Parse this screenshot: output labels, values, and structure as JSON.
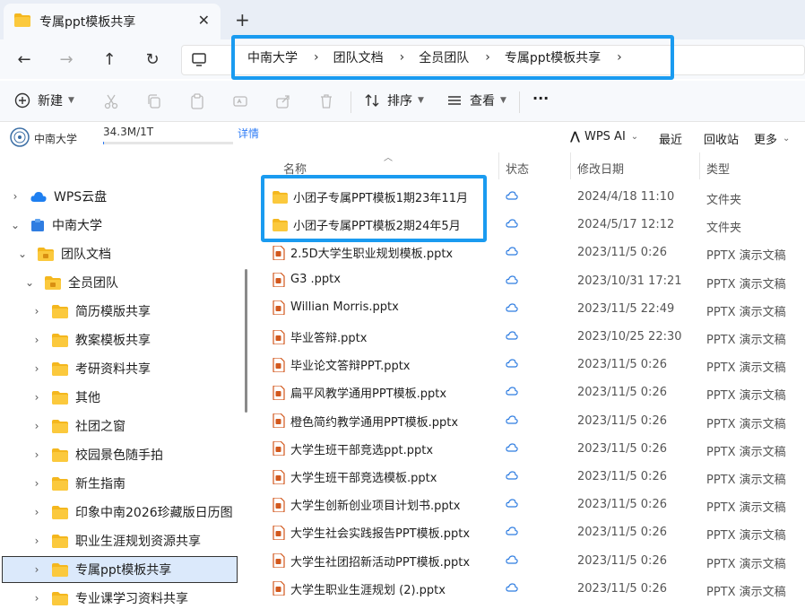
{
  "tab": {
    "title": "专属ppt模板共享",
    "close": "✕",
    "new": "+"
  },
  "nav": {
    "back": "←",
    "forward": "→",
    "up": "↑",
    "refresh": "↻",
    "breadcrumbs": [
      "中南大学",
      "团队文档",
      "全员团队",
      "专属ppt模板共享"
    ],
    "sep": "›"
  },
  "toolbar": {
    "new_label": "新建",
    "sort_label": "排序",
    "view_label": "查看",
    "more_label": "···"
  },
  "infobar": {
    "org": "中南大学",
    "quota": "34.3M/1T",
    "quota_fraction": 0.01,
    "detail": "详情",
    "wps_ai": "WPS AI",
    "recent": "最近",
    "recycle": "回收站",
    "more": "更多"
  },
  "sidebar": {
    "items": [
      {
        "label": "WPS云盘"
      },
      {
        "label": "中南大学"
      },
      {
        "label": "团队文档"
      },
      {
        "label": "全员团队"
      },
      {
        "label": "简历模版共享"
      },
      {
        "label": "教案模板共享"
      },
      {
        "label": "考研资料共享"
      },
      {
        "label": "其他"
      },
      {
        "label": "社团之窗"
      },
      {
        "label": "校园景色随手拍"
      },
      {
        "label": "新生指南"
      },
      {
        "label": "印象中南2026珍藏版日历图"
      },
      {
        "label": "职业生涯规划资源共享"
      },
      {
        "label": "专属ppt模板共享"
      },
      {
        "label": "专业课学习资料共享"
      }
    ]
  },
  "list": {
    "headers": {
      "name": "名称",
      "status": "状态",
      "date": "修改日期",
      "type": "类型"
    },
    "rows": [
      {
        "name": "小团子专属PPT模板1期23年11月",
        "date": "2024/4/18 11:10",
        "type": "文件夹"
      },
      {
        "name": "小团子专属PPT模板2期24年5月",
        "date": "2024/5/17 12:12",
        "type": "文件夹"
      },
      {
        "name": "2.5D大学生职业规划模板.pptx",
        "date": "2023/11/5 0:26",
        "type": "PPTX 演示文稿"
      },
      {
        "name": "G3 .pptx",
        "date": "2023/10/31 17:21",
        "type": "PPTX 演示文稿"
      },
      {
        "name": "Willian Morris.pptx",
        "date": "2023/11/5 22:49",
        "type": "PPTX 演示文稿"
      },
      {
        "name": "毕业答辩.pptx",
        "date": "2023/10/25 22:30",
        "type": "PPTX 演示文稿"
      },
      {
        "name": "毕业论文答辩PPT.pptx",
        "date": "2023/11/5 0:26",
        "type": "PPTX 演示文稿"
      },
      {
        "name": "扁平风教学通用PPT模板.pptx",
        "date": "2023/11/5 0:26",
        "type": "PPTX 演示文稿"
      },
      {
        "name": "橙色简约教学通用PPT模板.pptx",
        "date": "2023/11/5 0:26",
        "type": "PPTX 演示文稿"
      },
      {
        "name": "大学生班干部竞选ppt.pptx",
        "date": "2023/11/5 0:26",
        "type": "PPTX 演示文稿"
      },
      {
        "name": "大学生班干部竞选模板.pptx",
        "date": "2023/11/5 0:26",
        "type": "PPTX 演示文稿"
      },
      {
        "name": "大学生创新创业项目计划书.pptx",
        "date": "2023/11/5 0:26",
        "type": "PPTX 演示文稿"
      },
      {
        "name": "大学生社会实践报告PPT模板.pptx",
        "date": "2023/11/5 0:26",
        "type": "PPTX 演示文稿"
      },
      {
        "name": "大学生社团招新活动PPT模板.pptx",
        "date": "2023/11/5 0:26",
        "type": "PPTX 演示文稿"
      },
      {
        "name": "大学生职业生涯规划 (2).pptx",
        "date": "2023/11/5 0:26",
        "type": "PPTX 演示文稿"
      }
    ]
  },
  "colors": {
    "accent": "#1a9bf0",
    "folder": "#f4b71e",
    "pptx": "#d2581d",
    "selected": "#dbe9fb"
  }
}
